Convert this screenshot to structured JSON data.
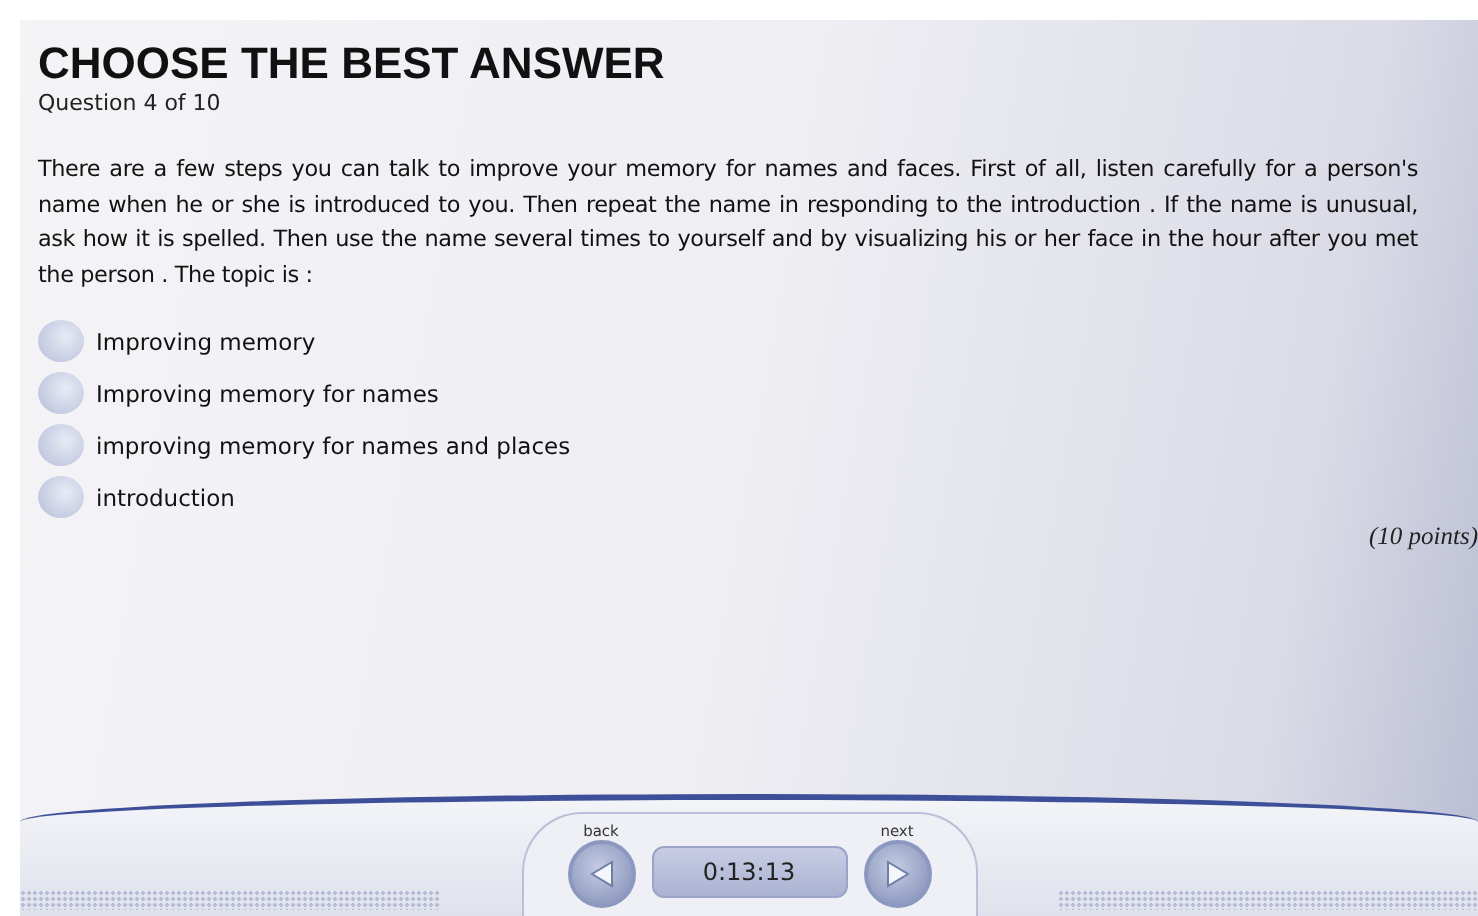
{
  "title": "CHOOSE THE BEST ANSWER",
  "progress": "Question 4 of 10",
  "question": "There are a few steps you can talk to improve your memory for names and faces. First of all, listen carefully for a person's name when he or she is introduced to you. Then repeat the name in responding to the introduction . If the name is unusual, ask how it is spelled. Then use the name several times to yourself and by visualizing his or her face in the hour after you met the person . The topic is :",
  "options": [
    {
      "label": "Improving memory",
      "selected": false
    },
    {
      "label": "Improving memory for names",
      "selected": false
    },
    {
      "label": "improving memory for names and places",
      "selected": false
    },
    {
      "label": "introduction",
      "selected": false
    }
  ],
  "points": "(10 points)",
  "nav": {
    "back": "back",
    "timer": "0:13:13",
    "next": "next"
  }
}
